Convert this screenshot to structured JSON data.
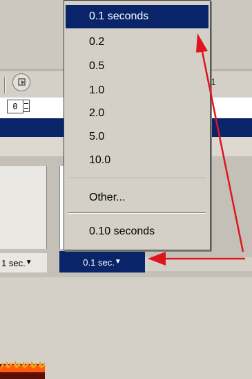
{
  "toolbar": {
    "button_icon": "playhead-icon",
    "right_glyph": "1"
  },
  "spinner": {
    "value": "0"
  },
  "timeline": {
    "left_rate_label": "1 sec.",
    "active_rate_label": "0.1 sec.",
    "dropdown_glyph": "▼"
  },
  "rate_menu": {
    "items": [
      {
        "label": "0.1 seconds",
        "selected": true
      },
      {
        "label": "0.2",
        "selected": false
      },
      {
        "label": "0.5",
        "selected": false
      },
      {
        "label": "1.0",
        "selected": false
      },
      {
        "label": "2.0",
        "selected": false
      },
      {
        "label": "5.0",
        "selected": false
      },
      {
        "label": "10.0",
        "selected": false
      }
    ],
    "other_label": "Other...",
    "current_label": "0.10 seconds"
  },
  "annotation": {
    "arrow_color": "#e0141e"
  },
  "colors": {
    "selection": "#0a246a",
    "face": "#d4d0c8"
  }
}
